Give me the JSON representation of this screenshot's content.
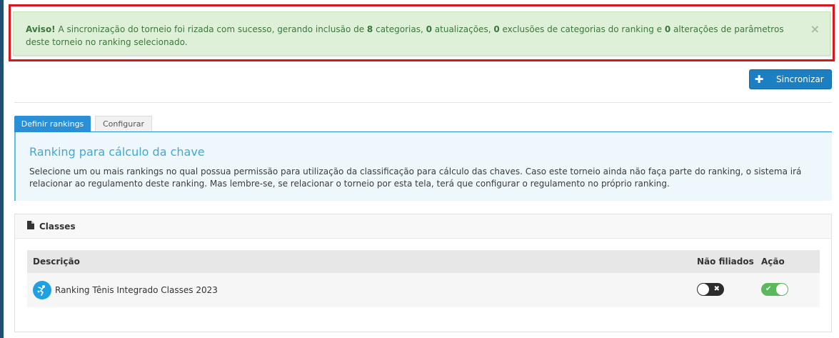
{
  "alert": {
    "prefix": "Aviso!",
    "t1": " A sincronização do torneio foi rizada com sucesso, gerando inclusão de ",
    "n1": "8",
    "t2": " categorias, ",
    "n2": "0",
    "t3": " atualizações, ",
    "n3": "0",
    "t4": " exclusões de categorias do ranking e ",
    "n4": "0",
    "t5": " alterações de parâmetros deste torneio no ranking selecionado.",
    "close": "×"
  },
  "sync_button": {
    "icon": "plus-icon",
    "label": "Sincronizar"
  },
  "tabs": [
    {
      "label": "Definir rankings",
      "active": true
    },
    {
      "label": "Configurar",
      "active": false
    }
  ],
  "info": {
    "title": "Ranking para cálculo da chave",
    "text": "Selecione um ou mais rankings no qual possua permissão para utilização da classificação para cálculo das chaves. Caso este torneio ainda não faça parte do ranking, o sistema irá relacionar ao regulamento deste ranking. Mas lembre-se, se relacionar o torneio por esta tela, terá que configurar o regulamento no próprio ranking."
  },
  "panel": {
    "title": "Classes",
    "icon": "document-icon",
    "columns": [
      "Descrição",
      "Não filiados",
      "Ação"
    ],
    "rows": [
      {
        "description": "Ranking Tênis Integrado Classes 2023",
        "nao_filiados": false,
        "acao": true
      }
    ]
  },
  "colors": {
    "alert_bg": "#dff0d8",
    "alert_text": "#3c763d",
    "primary": "#1b7fc2",
    "success": "#5cb85c",
    "highlight": "#d6171e"
  }
}
